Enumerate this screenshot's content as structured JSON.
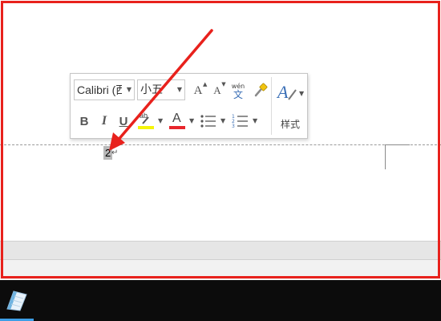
{
  "mini_toolbar": {
    "font_name": "Calibri (西",
    "font_size": "小五",
    "grow_font": "A",
    "shrink_font": "A",
    "phonetic_top": "wén",
    "phonetic_bottom": "文",
    "bold": "B",
    "italic": "I",
    "underline": "U",
    "highlight_top": "ab",
    "font_color_letter": "A",
    "styles_label": "样式"
  },
  "document": {
    "selected_text": "2",
    "paragraph_mark": "↵"
  },
  "colors": {
    "annotation_red": "#e8211c",
    "highlight_yellow": "#f5f50a",
    "font_color_red": "#e8262c",
    "styles_blue": "#3b6fb6",
    "taskbar_accent": "#3d9ee6"
  },
  "icons": {
    "grow_font": "grow-font-icon",
    "shrink_font": "shrink-font-icon",
    "phonetic": "phonetic-guide-icon",
    "format_painter": "format-painter-icon",
    "highlight": "text-highlight-icon",
    "font_color": "font-color-icon",
    "bullets": "bullets-icon",
    "numbering": "numbering-icon",
    "styles": "styles-icon",
    "taskbar_app": "notepad-app-icon"
  }
}
